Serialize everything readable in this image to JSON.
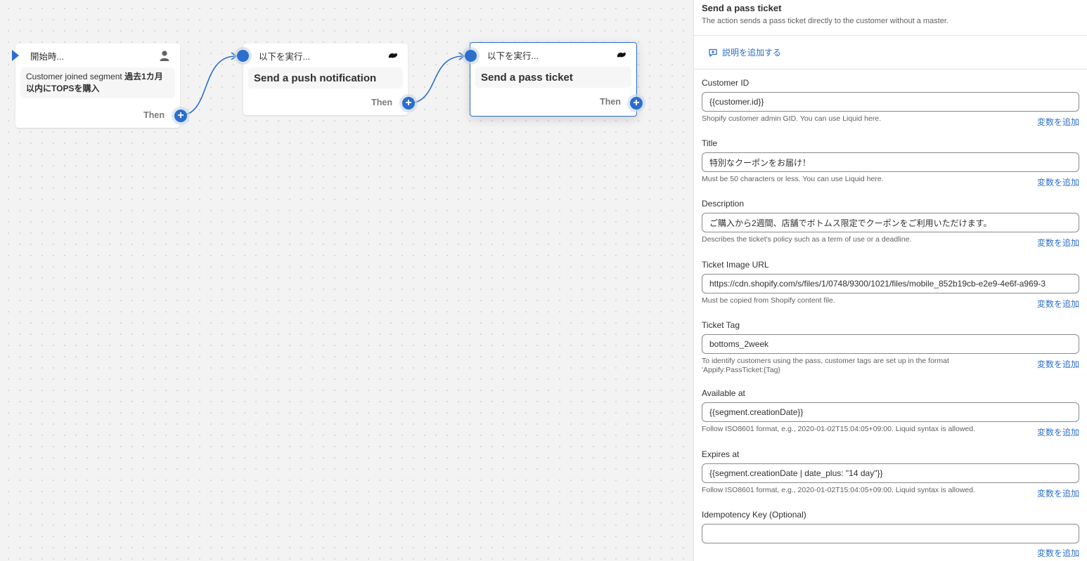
{
  "canvas": {
    "nodes": [
      {
        "header": "開始時...",
        "body_plain": "Customer joined segment ",
        "body_bold": "過去1カ月以内にTOPSを購入",
        "footer": "Then"
      },
      {
        "header": "以下を実行...",
        "body": "Send a push notification",
        "footer": "Then"
      },
      {
        "header": "以下を実行...",
        "body": "Send a pass ticket",
        "footer": "Then"
      }
    ],
    "plus_glyph": "+"
  },
  "panel": {
    "title": "Send a pass ticket",
    "subtitle": "The action sends a pass ticket directly to the customer without a master.",
    "add_description": "説明を追加する",
    "add_variable_label": "変数を追加",
    "fields": [
      {
        "label": "Customer ID",
        "value": "{{customer.id}}",
        "help": "Shopify customer admin GID. You can use Liquid here."
      },
      {
        "label": "Title",
        "value": "特別なクーポンをお届け！",
        "help": "Must be 50 characters or less. You can use Liquid here."
      },
      {
        "label": "Description",
        "value": "ご購入から2週間、店舗でボトムス限定でクーポンをご利用いただけます。",
        "help": "Describes the ticket's policy such as a term of use or a deadline."
      },
      {
        "label": "Ticket Image URL",
        "value": "https://cdn.shopify.com/s/files/1/0748/9300/1021/files/mobile_852b19cb-e2e9-4e6f-a969-3",
        "help": "Must be copied from Shopify content file."
      },
      {
        "label": "Ticket Tag",
        "value": "bottoms_2week",
        "help": "To identify customers using the pass, customer tags are set up in the format 'Appify:PassTicket:{Tag}"
      },
      {
        "label": "Available at",
        "value": "{{segment.creationDate}}",
        "help": "Follow ISO8601 format, e.g., 2020-01-02T15:04:05+09:00. Liquid syntax is allowed."
      },
      {
        "label": "Expires at",
        "value": "{{segment.creationDate | date_plus: \"14 day\"}}",
        "help": "Follow ISO8601 format, e.g., 2020-01-02T15:04:05+09:00. Liquid syntax is allowed."
      },
      {
        "label": "Idempotency Key (Optional)",
        "value": "",
        "help": ""
      }
    ]
  },
  "colors": {
    "accent": "#2c6ecb",
    "canvas_bg": "#f3f3f3"
  },
  "icons": {
    "trigger_node": "user-icon",
    "action_node": "app-logo-icon",
    "add_description": "comment-plus-icon",
    "add_step": "plus-icon",
    "start": "start-flag-icon"
  }
}
